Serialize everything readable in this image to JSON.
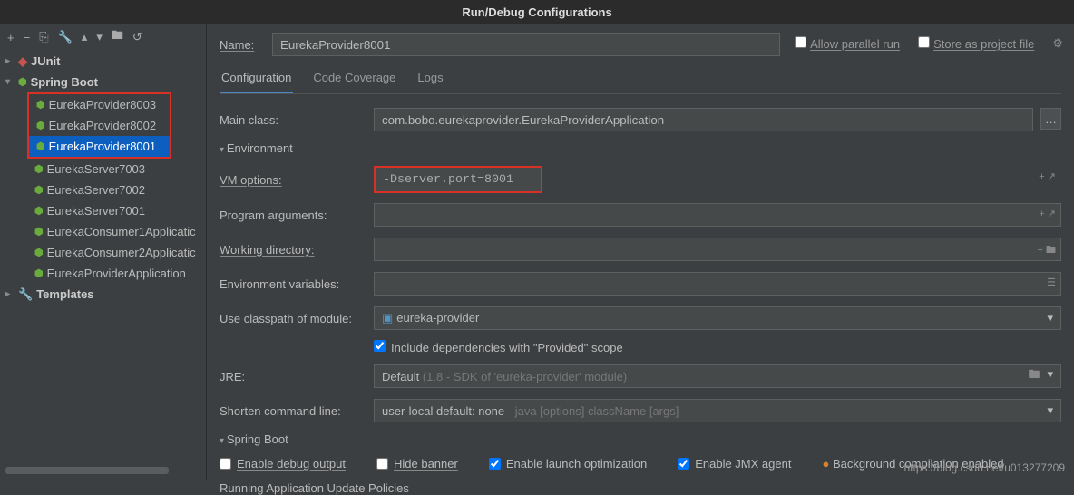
{
  "title": "Run/Debug Configurations",
  "toolbar": {
    "add": "+",
    "remove": "−",
    "copy_icon": "⎘",
    "wrench_icon": "🔧",
    "up_icon": "▴",
    "down_icon": "▾",
    "folder_icon": "🖿",
    "revert_icon": "↺"
  },
  "tree": {
    "junit": "JUnit",
    "springboot": "Spring Boot",
    "templates": "Templates",
    "items_highlighted": [
      "EurekaProvider8003",
      "EurekaProvider8002",
      "EurekaProvider8001"
    ],
    "items_rest": [
      "EurekaServer7003",
      "EurekaServer7002",
      "EurekaServer7001",
      "EurekaConsumer1Applicatic",
      "EurekaConsumer2Applicatic",
      "EurekaProviderApplication"
    ],
    "selected_index": 2
  },
  "name_label": "Name:",
  "name_value": "EurekaProvider8001",
  "allow_parallel": "Allow parallel run",
  "store_project": "Store as project file",
  "tabs": {
    "config": "Configuration",
    "coverage": "Code Coverage",
    "logs": "Logs"
  },
  "fields": {
    "main_class_label": "Main class:",
    "main_class_value": "com.bobo.eurekaprovider.EurekaProviderApplication",
    "env_header": "Environment",
    "vm_label": "VM options:",
    "vm_value": "-Dserver.port=8001",
    "prog_args_label": "Program arguments:",
    "working_dir_label": "Working directory:",
    "env_vars_label": "Environment variables:",
    "classpath_label": "Use classpath of module:",
    "classpath_value": "eureka-provider",
    "include_provided": "Include dependencies with \"Provided\" scope",
    "jre_label": "JRE:",
    "jre_value": "Default",
    "jre_hint": "(1.8 - SDK of 'eureka-provider' module)",
    "shorten_label": "Shorten command line:",
    "shorten_value": "user-local default: none",
    "shorten_hint": "- java [options] className [args]",
    "springboot_header": "Spring Boot",
    "enable_debug": "Enable debug output",
    "hide_banner": "Hide banner",
    "enable_launch_opt": "Enable launch optimization",
    "enable_jmx": "Enable JMX agent",
    "bg_compile": "Background compilation enabled",
    "running_update": "Running Application Update Policies"
  },
  "watermark": "https://blog.csdn.net/u013277209"
}
